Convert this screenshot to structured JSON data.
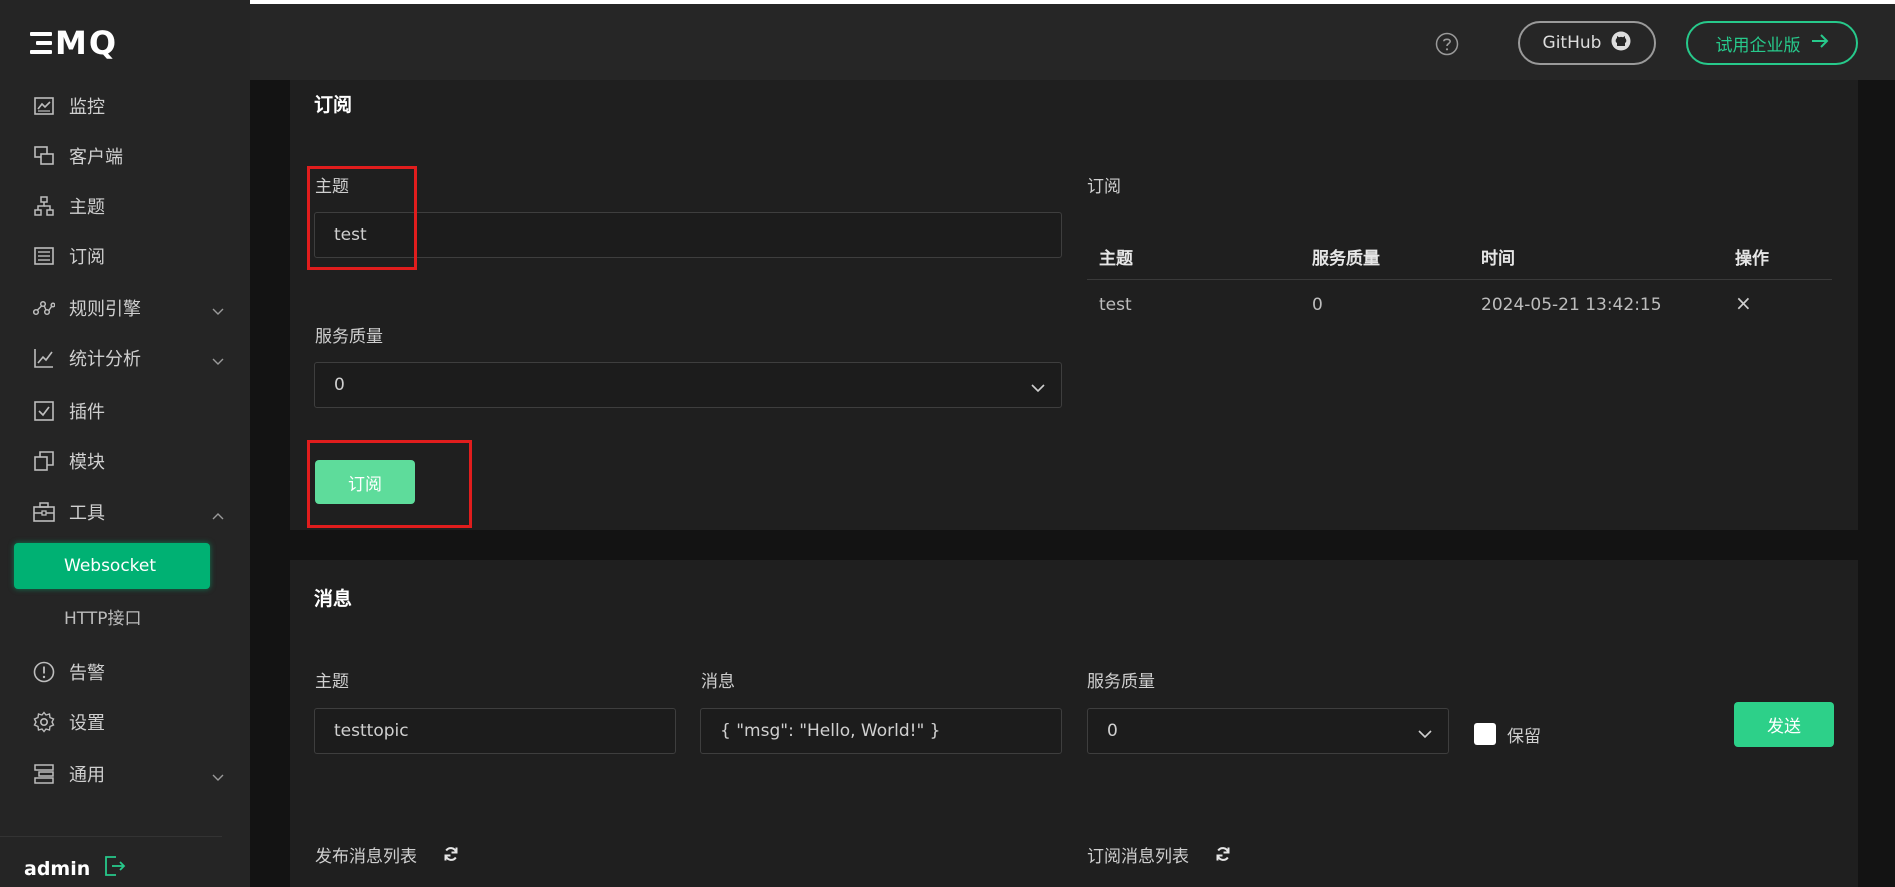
{
  "brand": {
    "logo_text": "MQ",
    "accent": "#00b173"
  },
  "sidebar": {
    "items": [
      {
        "label": "监控",
        "icon": "dashboard-icon"
      },
      {
        "label": "客户端",
        "icon": "clients-icon"
      },
      {
        "label": "主题",
        "icon": "topics-icon"
      },
      {
        "label": "订阅",
        "icon": "subscriptions-icon"
      },
      {
        "label": "规则引擎",
        "icon": "rule-engine-icon"
      },
      {
        "label": "统计分析",
        "icon": "analytics-icon"
      },
      {
        "label": "插件",
        "icon": "plugins-icon"
      },
      {
        "label": "模块",
        "icon": "modules-icon"
      },
      {
        "label": "工具",
        "icon": "tools-icon"
      },
      {
        "label": "告警",
        "icon": "alarm-icon"
      },
      {
        "label": "设置",
        "icon": "settings-icon"
      },
      {
        "label": "通用",
        "icon": "general-icon"
      }
    ],
    "tools_sub": [
      {
        "label": "Websocket",
        "active": true
      },
      {
        "label": "HTTP接口",
        "active": false
      }
    ],
    "user": "admin"
  },
  "topbar": {
    "github_label": "GitHub",
    "enterprise_label": "试用企业版"
  },
  "subscribe": {
    "title": "订阅",
    "topic_label": "主题",
    "topic_value": "test",
    "qos_label": "服务质量",
    "qos_value": "0",
    "button": "订阅",
    "table_title": "订阅",
    "columns": [
      "主题",
      "服务质量",
      "时间",
      "操作"
    ],
    "rows": [
      {
        "topic": "test",
        "qos": "0",
        "time": "2024-05-21 13:42:15",
        "action": "×"
      }
    ]
  },
  "message": {
    "title": "消息",
    "topic_label": "主题",
    "topic_value": "testtopic",
    "payload_label": "消息",
    "payload_value": "{ \"msg\": \"Hello, World!\" }",
    "qos_label": "服务质量",
    "qos_value": "0",
    "retain_label": "保留",
    "send_button": "发送",
    "published_list": "发布消息列表",
    "received_list": "订阅消息列表"
  }
}
